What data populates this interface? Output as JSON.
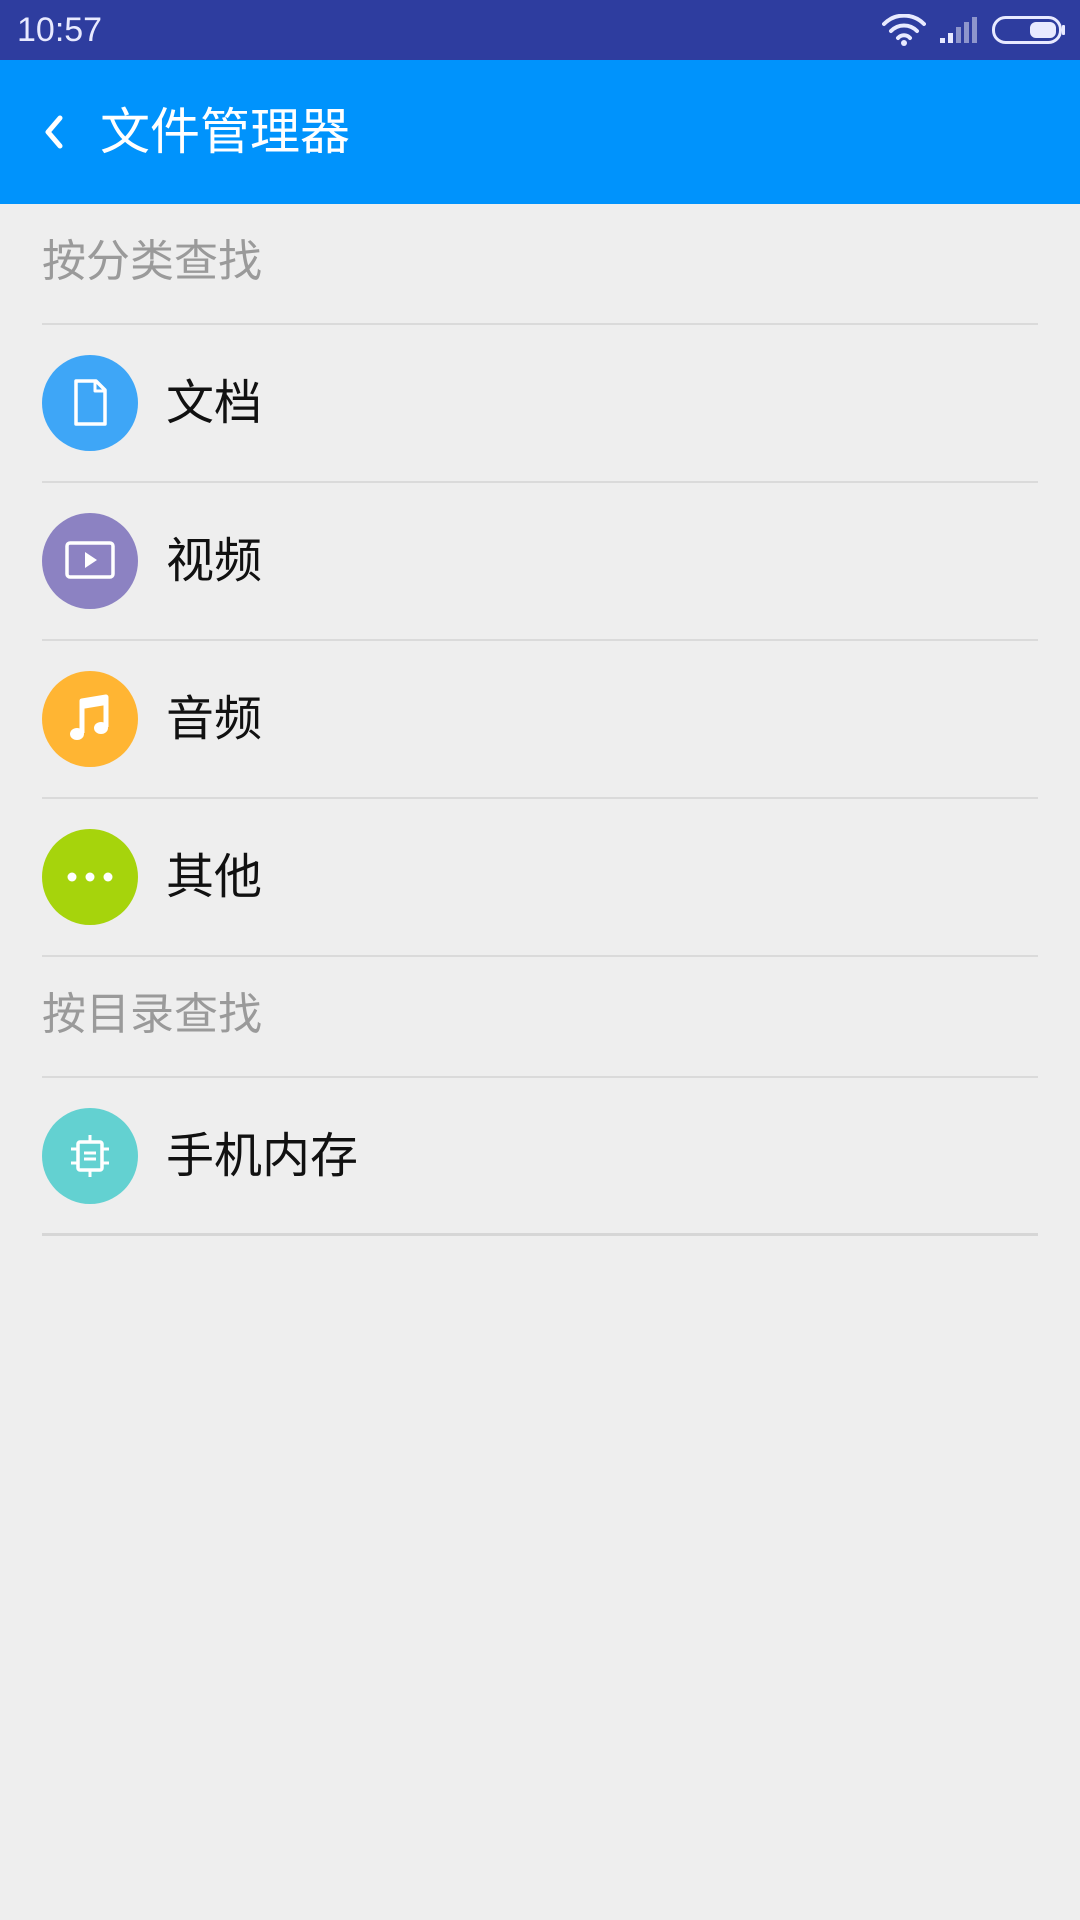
{
  "status_bar": {
    "time": "10:57",
    "icons": [
      "wifi-icon",
      "signal-icon",
      "battery-icon"
    ]
  },
  "app_bar": {
    "back_icon": "chevron-left-icon",
    "title": "文件管理器",
    "color": "#0093fc"
  },
  "category_section": {
    "header": "按分类查找",
    "items": [
      {
        "label": "文档",
        "icon": "document-icon",
        "color": "#3ea6f7"
      },
      {
        "label": "视频",
        "icon": "video-icon",
        "color": "#8c82c2"
      },
      {
        "label": "音频",
        "icon": "music-icon",
        "color": "#ffb533"
      },
      {
        "label": "其他",
        "icon": "more-icon",
        "color": "#a6d40c"
      }
    ]
  },
  "directory_section": {
    "header": "按目录查找",
    "items": [
      {
        "label": "手机内存",
        "icon": "chip-icon",
        "color": "#63d1d1"
      }
    ]
  }
}
